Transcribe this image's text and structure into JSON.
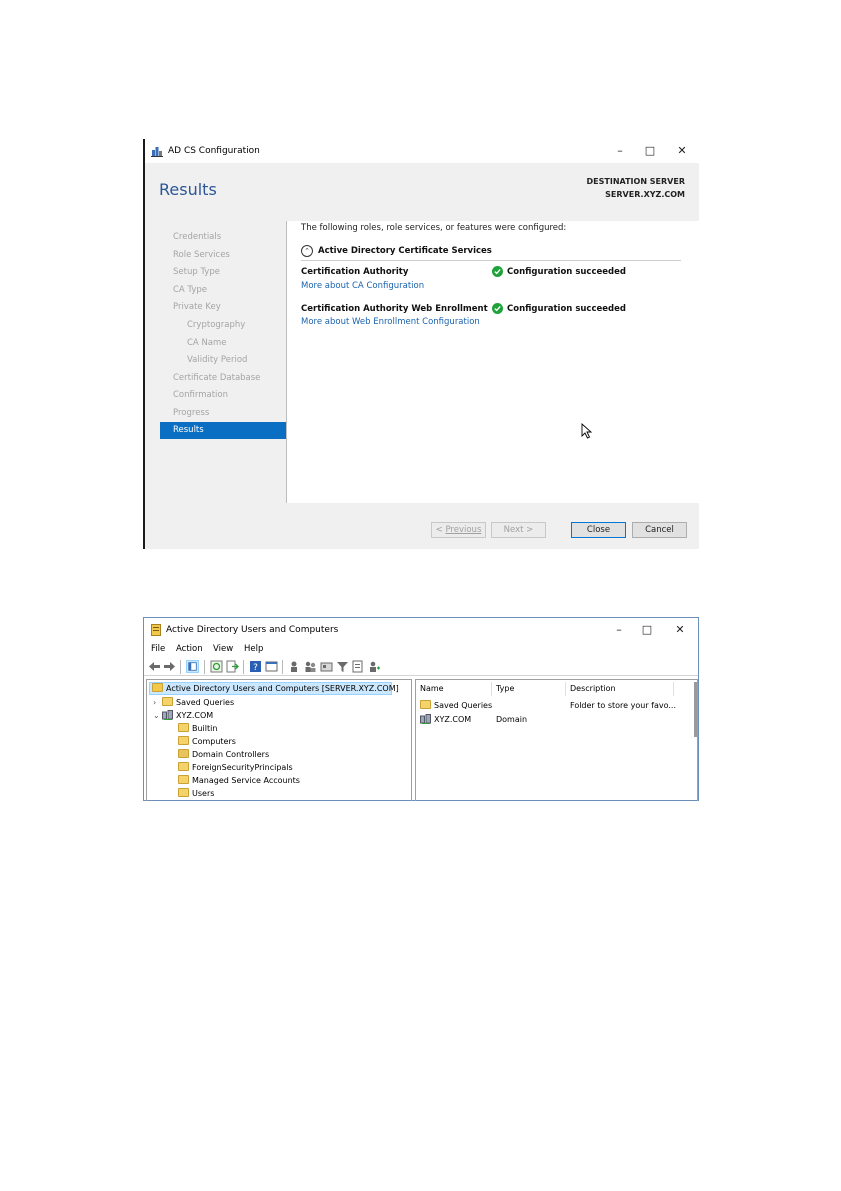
{
  "adcs": {
    "window_title": "AD CS Configuration",
    "page_title": "Results",
    "destination_label": "DESTINATION SERVER",
    "destination_server": "SERVER.XYZ.COM",
    "nav": [
      {
        "label": "Credentials"
      },
      {
        "label": "Role Services"
      },
      {
        "label": "Setup Type"
      },
      {
        "label": "CA Type"
      },
      {
        "label": "Private Key"
      },
      {
        "label": "Cryptography"
      },
      {
        "label": "CA Name"
      },
      {
        "label": "Validity Period"
      },
      {
        "label": "Certificate Database"
      },
      {
        "label": "Confirmation"
      },
      {
        "label": "Progress"
      },
      {
        "label": "Results"
      }
    ],
    "intro": "The following roles, role services, or features were configured:",
    "section_title": "Active Directory Certificate Services",
    "results": [
      {
        "name": "Certification Authority",
        "link": "More about CA Configuration",
        "status": "Configuration succeeded"
      },
      {
        "name": "Certification Authority Web Enrollment",
        "link": "More about Web Enrollment Configuration",
        "status": "Configuration succeeded"
      }
    ],
    "buttons": {
      "previous": "Previous",
      "next": "Next >",
      "close": "Close",
      "cancel": "Cancel"
    },
    "colors": {
      "accent": "#0a6fc2",
      "title": "#2b5797",
      "success": "#1fa23a",
      "link": "#1a63b0"
    }
  },
  "aduc": {
    "window_title": "Active Directory Users and Computers",
    "menu": [
      "File",
      "Action",
      "View",
      "Help"
    ],
    "tree": {
      "root": "Active Directory Users and Computers [SERVER.XYZ.COM]",
      "saved_queries": "Saved Queries",
      "domain": "XYZ.COM",
      "children": [
        "Builtin",
        "Computers",
        "Domain Controllers",
        "ForeignSecurityPrincipals",
        "Managed Service Accounts",
        "Users"
      ]
    },
    "columns": [
      "Name",
      "Type",
      "Description"
    ],
    "rows": [
      {
        "name": "Saved Queries",
        "type": "",
        "description": "Folder to store your favo..."
      },
      {
        "name": "XYZ.COM",
        "type": "Domain",
        "description": ""
      }
    ]
  }
}
